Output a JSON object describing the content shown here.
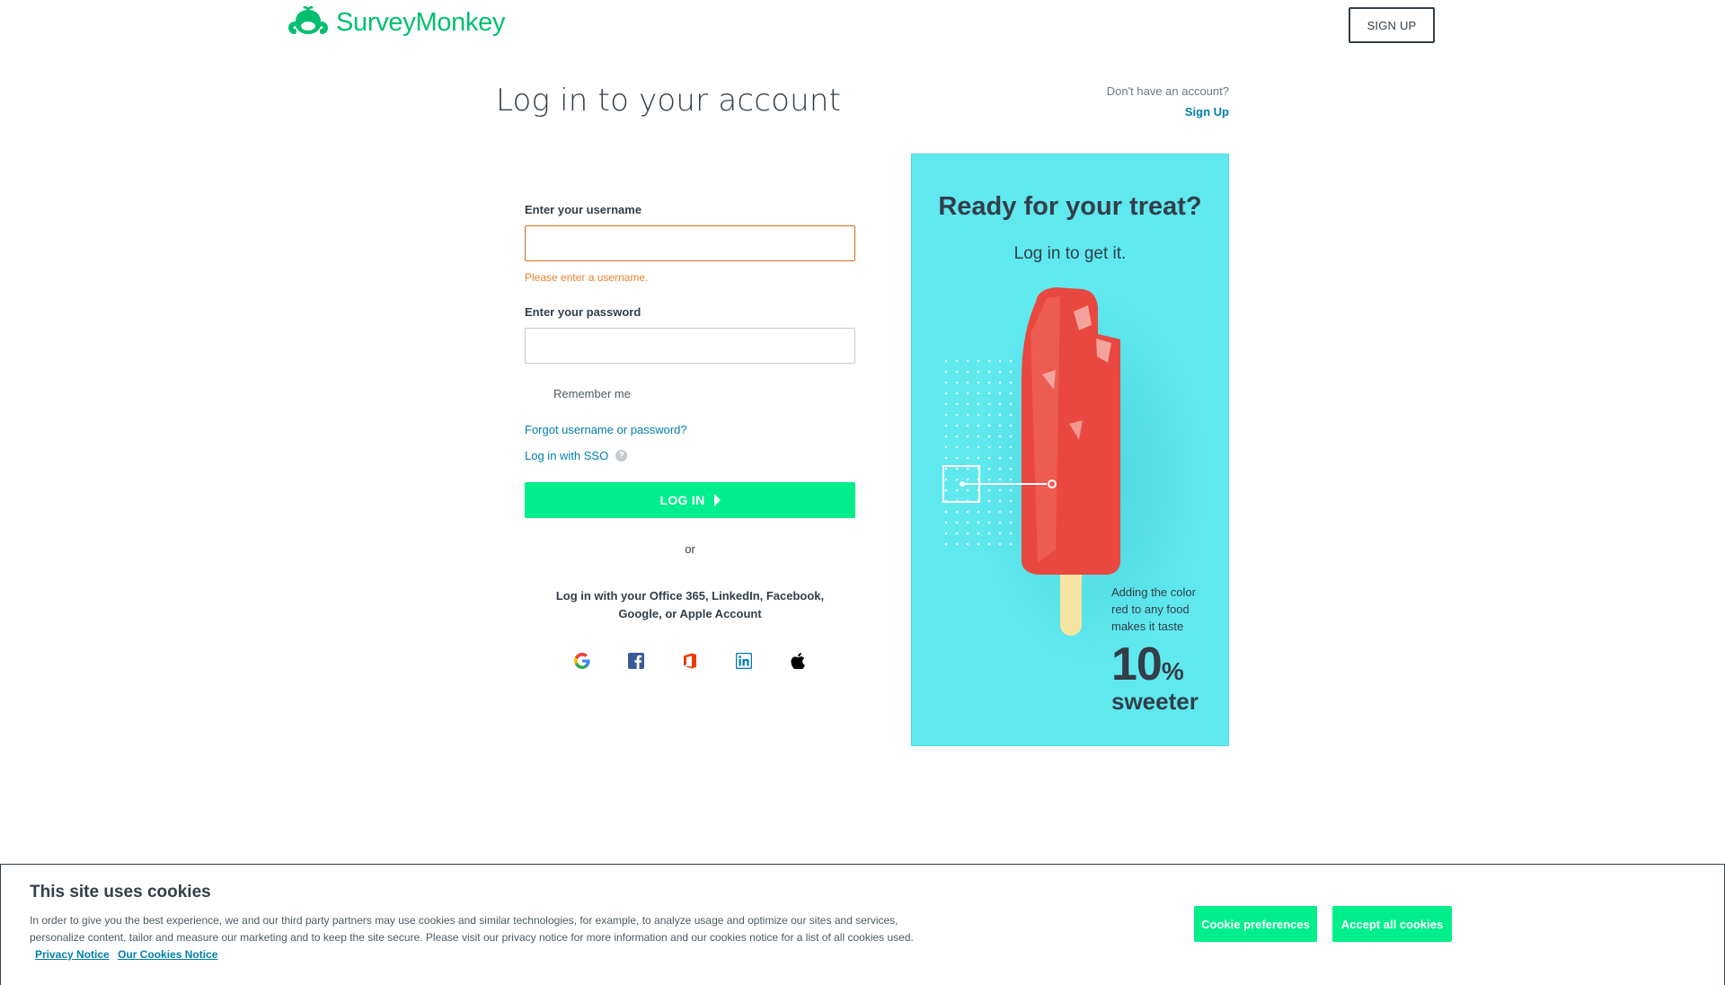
{
  "header": {
    "logo_text": "SurveyMonkey",
    "signup_label": "SIGN UP"
  },
  "main": {
    "title": "Log in to your account",
    "no_account_text": "Don't have an account?",
    "no_account_link": "Sign Up"
  },
  "form": {
    "username_label": "Enter your username",
    "username_value": "",
    "username_error": "Please enter a username.",
    "password_label": "Enter your password",
    "password_value": "",
    "remember_label": "Remember me",
    "forgot_link": "Forgot username or password?",
    "sso_link": "Log in with SSO",
    "help_glyph": "?",
    "login_label": "LOG IN",
    "or_text": "or",
    "social_text": "Log in with your Office 365, LinkedIn, Facebook, Google, or Apple Account",
    "social_icons": [
      "google-icon",
      "facebook-icon",
      "office-icon",
      "linkedin-icon",
      "apple-icon"
    ]
  },
  "promo": {
    "title": "Ready for your treat?",
    "subtitle": "Log in to get it.",
    "fact_text": "Adding the color red to any food makes it taste",
    "fact_number": "10",
    "fact_unit": "%",
    "fact_word": "sweeter",
    "background_color": "#5fe9ef"
  },
  "cookie_banner": {
    "title": "This site uses cookies",
    "text": "In order to give you the best experience, we and our third party partners may use cookies and similar technologies, for example, to analyze usage and optimize our sites and services, personalize content, tailor and measure our marketing and to keep the site secure. Please visit our privacy notice for more information and our cookies notice for a list of all cookies used.",
    "privacy_link": "Privacy Notice",
    "cookies_link": "Our Cookies Notice",
    "preferences_label": "Cookie preferences",
    "accept_label": "Accept all cookies"
  },
  "colors": {
    "brand_green": "#00bf6f",
    "button_green": "#00ef8b",
    "link_blue": "#007faa",
    "error_orange": "#e8822f",
    "text_dark": "#333e48"
  }
}
